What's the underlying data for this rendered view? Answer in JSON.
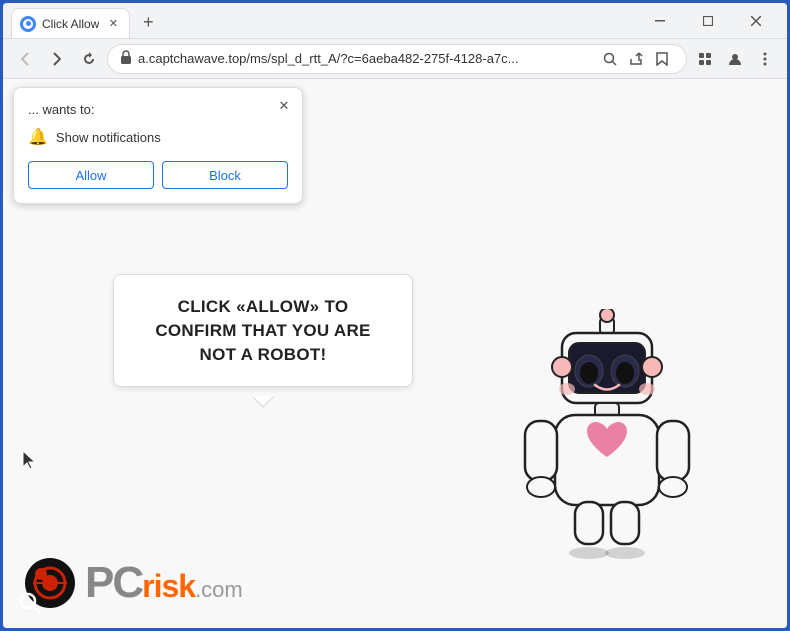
{
  "window": {
    "title": "Click Allow",
    "favicon_color": "#4285f4"
  },
  "browser": {
    "address": "a.captchawave.top/ms/spl_d_rtt_A/?c=6aeba482-275f-4128-a7c...",
    "tab_label": "Click Allow",
    "nav_back": "←",
    "nav_forward": "→",
    "nav_refresh": "↺",
    "new_tab_icon": "+",
    "minimize_icon": "─",
    "maximize_icon": "□",
    "close_icon": "✕"
  },
  "popup": {
    "wants_label": "... wants to:",
    "notification_label": "Show notifications",
    "allow_button": "Allow",
    "block_button": "Block",
    "close_icon": "✕"
  },
  "page": {
    "bubble_text": "CLICK «ALLOW» TO CONFIRM THAT YOU ARE NOT A ROBOT!",
    "logo_pc": "PC",
    "logo_risk": "risk",
    "logo_dot_com": ".com"
  },
  "icons": {
    "lock": "🔒",
    "search": "🔍",
    "share": "⎙",
    "star": "☆",
    "extensions": "⬜",
    "profile": "👤",
    "menu": "⋮",
    "bell": "🔔"
  }
}
